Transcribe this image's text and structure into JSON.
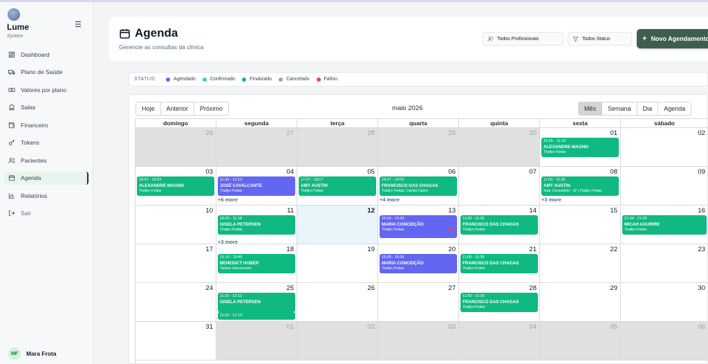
{
  "brand": {
    "name": "Lume",
    "sub": "System"
  },
  "sidebar": {
    "items": [
      {
        "label": "Dashboard",
        "icon": "dashboard-icon",
        "active": false
      },
      {
        "label": "Plano de Saúde",
        "icon": "truck-icon",
        "active": false
      },
      {
        "label": "Valores por plano",
        "icon": "money-icon",
        "active": false
      },
      {
        "label": "Salas",
        "icon": "building-icon",
        "active": false
      },
      {
        "label": "Financeiro",
        "icon": "wallet-icon",
        "active": false
      },
      {
        "label": "Tokens",
        "icon": "key-icon",
        "active": false
      },
      {
        "label": "Pacientes",
        "icon": "users-icon",
        "active": false
      },
      {
        "label": "Agenda",
        "icon": "calendar-icon",
        "active": true
      },
      {
        "label": "Relatórios",
        "icon": "bar-chart-icon",
        "active": false
      },
      {
        "label": "Sair",
        "icon": "logout-icon",
        "active": false
      }
    ]
  },
  "user": {
    "initials": "MF",
    "name": "Mara Frota"
  },
  "header": {
    "title": "Agenda",
    "subtitle": "Gerencie as consultas da clínica",
    "prof_filter": "Todos Profissionais",
    "status_filter": "Todos Status",
    "new_button": "Novo Agendamento"
  },
  "status_bar": {
    "label": "STATUS:",
    "items": [
      {
        "label": "Agendado",
        "color": "#6366f1"
      },
      {
        "label": "Confirmado",
        "color": "#2dd4bf"
      },
      {
        "label": "Finalizado",
        "color": "#10b981"
      },
      {
        "label": "Cancelado",
        "color": "#9ca3af"
      },
      {
        "label": "Faltou",
        "color": "#ef4444"
      }
    ]
  },
  "calendar": {
    "nav_buttons": [
      "Hoje",
      "Anterior",
      "Próximo"
    ],
    "title": "maio 2026",
    "views": [
      "Mês",
      "Semana",
      "Dia",
      "Agenda"
    ],
    "active_view": "Mês",
    "weekdays": [
      "domingo",
      "segunda",
      "terça",
      "quarta",
      "quinta",
      "sexta",
      "sábado"
    ],
    "weeks": [
      [
        {
          "d": "26",
          "o": true
        },
        {
          "d": "27",
          "o": true
        },
        {
          "d": "28",
          "o": true
        },
        {
          "d": "29",
          "o": true
        },
        {
          "d": "30",
          "o": true
        },
        {
          "d": "01",
          "events": [
            {
              "time": "10:35 - 11:10",
              "name": "ALEXANDRE MAGNO",
              "prof": "Thallys Freitas",
              "c": "g"
            }
          ]
        },
        {
          "d": "02"
        }
      ],
      [
        {
          "d": "03",
          "events": [
            {
              "time": "18:47 - 19:22",
              "name": "ALEXANDRE MAGNO",
              "prof": "Thallys Freitas",
              "c": "g"
            }
          ]
        },
        {
          "d": "04",
          "events": [
            {
              "time": "11:33 - 12:13",
              "name": "JOSÉ CAVALCANTE",
              "prof": "Thallys Freitas",
              "c": "b"
            }
          ],
          "more": "+6 more"
        },
        {
          "d": "05",
          "events": [
            {
              "time": "17:27 - 18:17",
              "name": "AMY AUSTIN",
              "prof": "Thallys Freitas",
              "c": "g"
            }
          ]
        },
        {
          "d": "06",
          "events": [
            {
              "time": "14:27 - 15:02",
              "name": "FRANCISCO DAS CHAGAS",
              "prof": "Thallys Freitas, Camila Castro",
              "c": "g"
            }
          ],
          "more": "+4 more"
        },
        {
          "d": "07"
        },
        {
          "d": "08",
          "events": [
            {
              "time": "11:00 - 11:35",
              "name": "AMY AUSTIN",
              "prof": "Sala: Consultório - 02 | Thallys Freitas",
              "c": "g"
            }
          ],
          "more": "+3 more"
        },
        {
          "d": "09"
        }
      ],
      [
        {
          "d": "10"
        },
        {
          "d": "11",
          "events": [
            {
              "time": "10:43 - 11:18",
              "name": "GISELA PETERSEN",
              "prof": "Thallys Freitas",
              "c": "g"
            }
          ],
          "more": "+3 more"
        },
        {
          "d": "12",
          "today": true
        },
        {
          "d": "13",
          "events": [
            {
              "time": "15:00 - 15:30",
              "name": "MARIA CONCEIÇÃO",
              "prof": "Thallys Freitas",
              "c": "b",
              "pin": true,
              "tall": true
            }
          ]
        },
        {
          "d": "14",
          "events": [
            {
              "time": "11:00 - 11:35",
              "name": "FRANCISCO DAS CHAGAS",
              "prof": "Thallys Freitas",
              "c": "g"
            }
          ]
        },
        {
          "d": "15"
        },
        {
          "d": "16",
          "events": [
            {
              "time": "21:04 - 21:39",
              "name": "MICAH AGUIRRE",
              "prof": "Thallys Freitas",
              "c": "g"
            }
          ]
        }
      ],
      [
        {
          "d": "17"
        },
        {
          "d": "18",
          "events": [
            {
              "time": "10:10 - 10:45",
              "name": "BENEDICT HUBER",
              "prof": "Tatiana Vasconcelos",
              "c": "g"
            }
          ]
        },
        {
          "d": "19"
        },
        {
          "d": "20",
          "events": [
            {
              "time": "15:00 - 15:30",
              "name": "MARIA CONCEIÇÃO",
              "prof": "Thallys Freitas",
              "c": "b"
            }
          ]
        },
        {
          "d": "21",
          "events": [
            {
              "time": "11:00 - 11:35",
              "name": "FRANCISCO DAS CHAGAS",
              "prof": "Thallys Freitas",
              "c": "g"
            }
          ]
        },
        {
          "d": "22"
        },
        {
          "d": "23"
        }
      ],
      [
        {
          "d": "24"
        },
        {
          "d": "25",
          "events": [
            {
              "time": "11:33 - 12:13",
              "name": "GISELA PETERSEN",
              "prof": "",
              "c": "g"
            },
            {
              "time": "11:33 - 12:13",
              "name": "",
              "prof": "",
              "c": "g",
              "clip": true
            }
          ]
        },
        {
          "d": "26"
        },
        {
          "d": "27"
        },
        {
          "d": "28",
          "events": [
            {
              "time": "11:00 - 11:30",
              "name": "FRANCISCO DAS CHAGAS",
              "prof": "Thallys Freitas",
              "c": "g"
            }
          ]
        },
        {
          "d": "29"
        },
        {
          "d": "30"
        }
      ],
      [
        {
          "d": "31"
        },
        {
          "d": "01",
          "o": true
        },
        {
          "d": "02",
          "o": true
        },
        {
          "d": "03",
          "o": true
        },
        {
          "d": "04",
          "o": true
        },
        {
          "d": "05",
          "o": true
        },
        {
          "d": "06",
          "o": true
        }
      ]
    ]
  }
}
